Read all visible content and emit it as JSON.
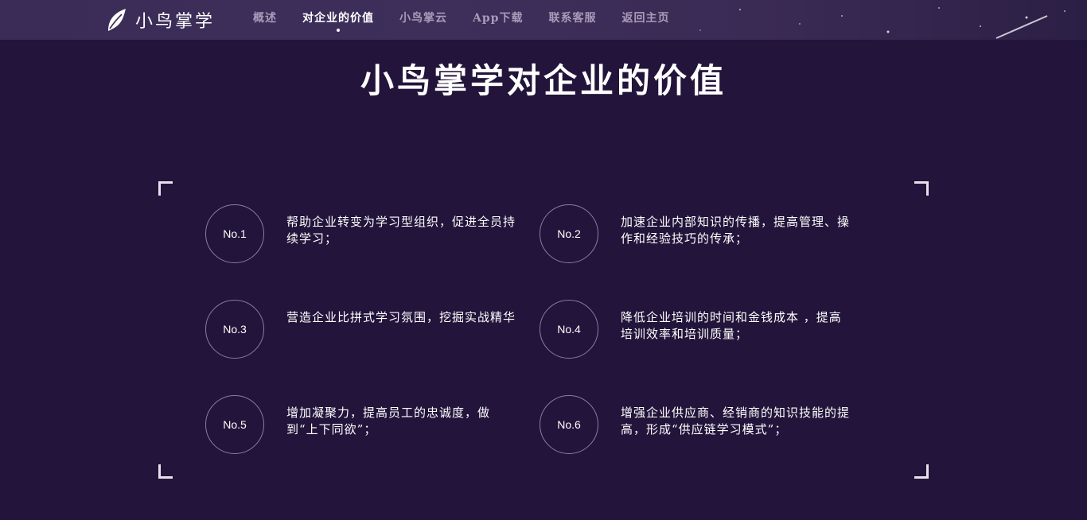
{
  "header": {
    "brand": "小鸟掌学",
    "nav": [
      {
        "label": "概述",
        "active": false
      },
      {
        "label": "对企业的价值",
        "active": true
      },
      {
        "label": "小鸟掌云",
        "active": false
      },
      {
        "label": "App下载",
        "active": false
      },
      {
        "label": "联系客服",
        "active": false
      },
      {
        "label": "返回主页",
        "active": false
      }
    ]
  },
  "main": {
    "title": "小鸟掌学对企业的价值",
    "items": [
      {
        "badge": "No.1",
        "text": "帮助企业转变为学习型组织，促进全员持续学习；"
      },
      {
        "badge": "No.2",
        "text": "加速企业内部知识的传播，提高管理、操作和经验技巧的传承；"
      },
      {
        "badge": "No.3",
        "text": "营造企业比拼式学习氛围，挖掘实战精华"
      },
      {
        "badge": "No.4",
        "text": "降低企业培训的时间和金钱成本 ，提高培训效率和培训质量；"
      },
      {
        "badge": "No.5",
        "text": "增加凝聚力，提高员工的忠诚度，做到“上下同欲”；"
      },
      {
        "badge": "No.6",
        "text": "增强企业供应商、经销商的知识技能的提高，形成“供应链学习模式”；"
      }
    ]
  },
  "colors": {
    "background": "#22143a",
    "header": "#3a2c56",
    "nav_inactive": "#a99bb8",
    "badge_border": "#8a7ca2"
  },
  "icons": {
    "logo": "bird-feather-icon"
  }
}
